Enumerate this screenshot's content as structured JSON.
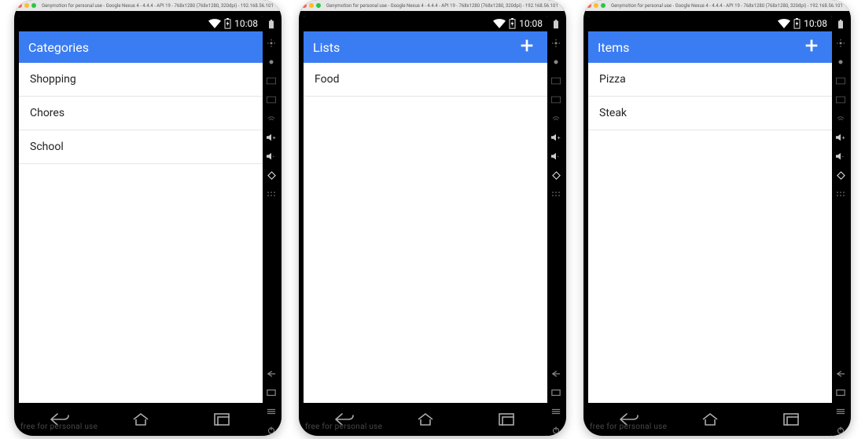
{
  "accent": "#3a7cf2",
  "watermark": "free for personal use",
  "window_chrome_title": "Genymotion for personal use - Google Nexus 4 - 4.4.4 - API 19 - 768x1280 (768x1280, 320dpi) - 192.168.56.101",
  "status": {
    "time": "10:08"
  },
  "devices": [
    {
      "appbar": {
        "title": "Categories",
        "has_add": false
      },
      "rows": [
        "Shopping",
        "Chores",
        "School"
      ]
    },
    {
      "appbar": {
        "title": "Lists",
        "has_add": true
      },
      "rows": [
        "Food"
      ]
    },
    {
      "appbar": {
        "title": "Items",
        "has_add": true
      },
      "rows": [
        "Pizza",
        "Steak"
      ]
    }
  ]
}
